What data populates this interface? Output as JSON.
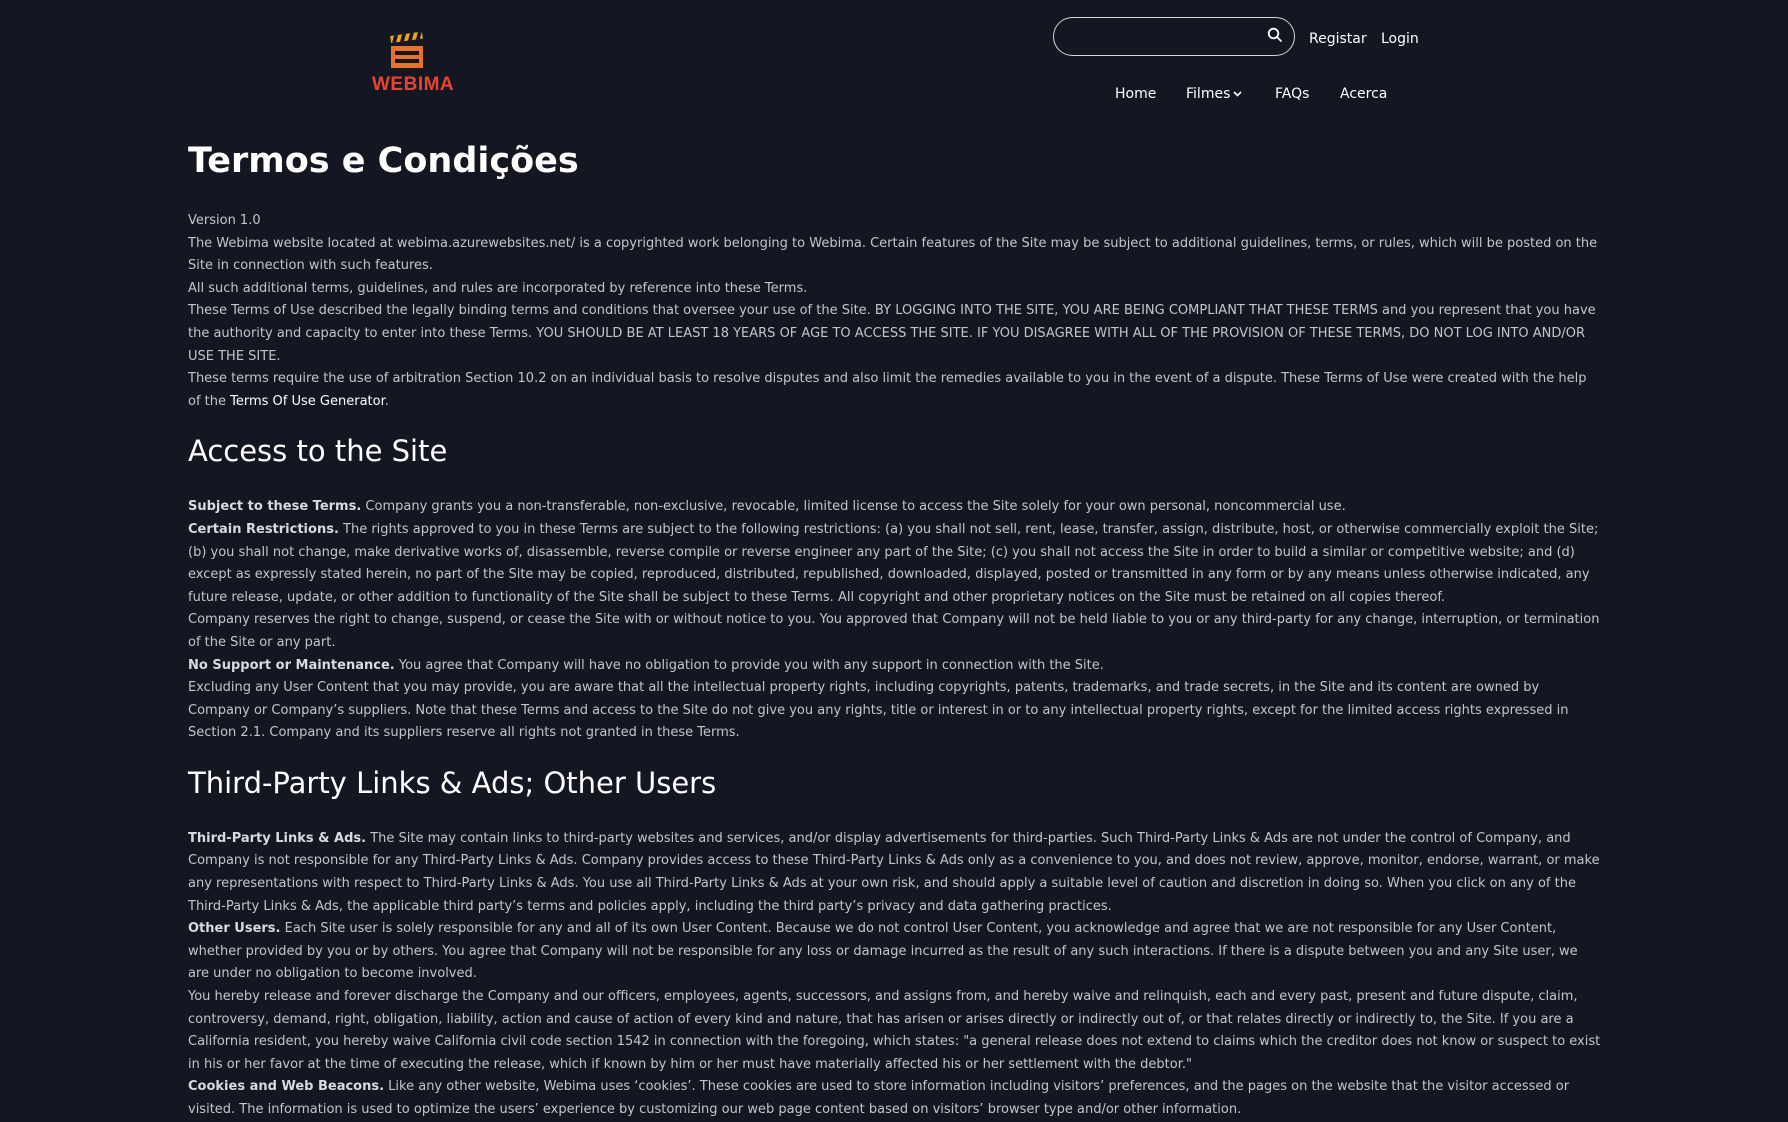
{
  "brand": {
    "name": "WEBIMA",
    "logo_icon": "clapperboard-icon",
    "logo_colors": {
      "top": "#f0a31c",
      "board": "#e9722a",
      "text": "#e8442e"
    }
  },
  "search": {
    "placeholder": "",
    "value": "",
    "icon": "search-icon"
  },
  "auth": {
    "register": "Registar",
    "login": "Login"
  },
  "nav": {
    "home": "Home",
    "films": "Filmes",
    "faqs": "FAQs",
    "about": "Acerca"
  },
  "page": {
    "title": "Termos e Condições"
  },
  "intro": {
    "version": "Version 1.0",
    "p1": "The Webima website located at webima.azurewebsites.net/ is a copyrighted work belonging to Webima. Certain features of the Site may be subject to additional guidelines, terms, or rules, which will be posted on the Site in connection with such features.",
    "p2": "All such additional terms, guidelines, and rules are incorporated by reference into these Terms.",
    "p3": "These Terms of Use described the legally binding terms and conditions that oversee your use of the Site. BY LOGGING INTO THE SITE, YOU ARE BEING COMPLIANT THAT THESE TERMS and you represent that you have the authority and capacity to enter into these Terms. YOU SHOULD BE AT LEAST 18 YEARS OF AGE TO ACCESS THE SITE. IF YOU DISAGREE WITH ALL OF THE PROVISION OF THESE TERMS, DO NOT LOG INTO AND/OR USE THE SITE.",
    "p4_pre": "These terms require the use of arbitration Section 10.2 on an individual basis to resolve disputes and also limit the remedies available to you in the event of a dispute. These Terms of Use were created with the help of the ",
    "p4_link": "Terms Of Use Generator",
    "p4_post": "."
  },
  "access": {
    "heading": "Access to the Site",
    "subject_label": "Subject to these Terms.",
    "subject_text": " Company grants you a non-transferable, non-exclusive, revocable, limited license to access the Site solely for your own personal, noncommercial use.",
    "restrictions_label": "Certain Restrictions.",
    "restrictions_text": " The rights approved to you in these Terms are subject to the following restrictions: (a) you shall not sell, rent, lease, transfer, assign, distribute, host, or otherwise commercially exploit the Site; (b) you shall not change, make derivative works of, disassemble, reverse compile or reverse engineer any part of the Site; (c) you shall not access the Site in order to build a similar or competitive website; and (d) except as expressly stated herein, no part of the Site may be copied, reproduced, distributed, republished, downloaded, displayed, posted or transmitted in any form or by any means unless otherwise indicated, any future release, update, or other addition to functionality of the Site shall be subject to these Terms. All copyright and other proprietary notices on the Site must be retained on all copies thereof.",
    "reserves": "Company reserves the right to change, suspend, or cease the Site with or without notice to you. You approved that Company will not be held liable to you or any third-party for any change, interruption, or termination of the Site or any part.",
    "support_label": "No Support or Maintenance.",
    "support_text": " You agree that Company will have no obligation to provide you with any support in connection with the Site.",
    "excluding": "Excluding any User Content that you may provide, you are aware that all the intellectual property rights, including copyrights, patents, trademarks, and trade secrets, in the Site and its content are owned by Company or Company’s suppliers. Note that these Terms and access to the Site do not give you any rights, title or interest in or to any intellectual property rights, except for the limited access rights expressed in Section 2.1. Company and its suppliers reserve all rights not granted in these Terms."
  },
  "thirdparty": {
    "heading": "Third-Party Links & Ads; Other Users",
    "links_label": "Third-Party Links & Ads.",
    "links_text": " The Site may contain links to third-party websites and services, and/or display advertisements for third-parties. Such Third-Party Links & Ads are not under the control of Company, and Company is not responsible for any Third-Party Links & Ads. Company provides access to these Third-Party Links & Ads only as a convenience to you, and does not review, approve, monitor, endorse, warrant, or make any representations with respect to Third-Party Links & Ads. You use all Third-Party Links & Ads at your own risk, and should apply a suitable level of caution and discretion in doing so. When you click on any of the Third-Party Links & Ads, the applicable third party’s terms and policies apply, including the third party’s privacy and data gathering practices.",
    "users_label": "Other Users.",
    "users_text": " Each Site user is solely responsible for any and all of its own User Content. Because we do not control User Content, you acknowledge and agree that we are not responsible for any User Content, whether provided by you or by others. You agree that Company will not be responsible for any loss or damage incurred as the result of any such interactions. If there is a dispute between you and any Site user, we are under no obligation to become involved.",
    "release": "You hereby release and forever discharge the Company and our officers, employees, agents, successors, and assigns from, and hereby waive and relinquish, each and every past, present and future dispute, claim, controversy, demand, right, obligation, liability, action and cause of action of every kind and nature, that has arisen or arises directly or indirectly out of, or that relates directly or indirectly to, the Site. If you are a California resident, you hereby waive California civil code section 1542 in connection with the foregoing, which states: \"a general release does not extend to claims which the creditor does not know or suspect to exist in his or her favor at the time of executing the release, which if known by him or her must have materially affected his or her settlement with the debtor.\"",
    "cookies_label": "Cookies and Web Beacons.",
    "cookies_text": " Like any other website, Webima uses ‘cookies’. These cookies are used to store information including visitors’ preferences, and the pages on the website that the visitor accessed or visited. The information is used to optimize the users’ experience by customizing our web page content based on visitors’ browser type and/or other information."
  }
}
